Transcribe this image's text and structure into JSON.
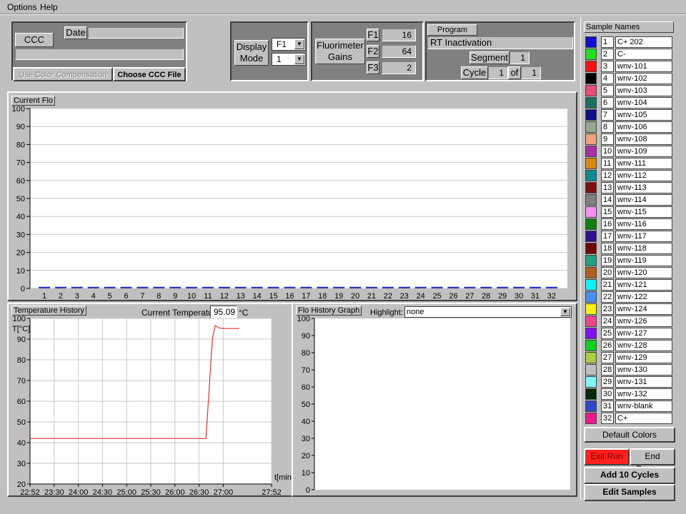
{
  "menu": {
    "options": "Options",
    "help": "Help"
  },
  "ccc": {
    "file_label": "CCC File",
    "date_label": "Date",
    "date_value": "",
    "file_value": "",
    "use_color_comp": "Use Color Compensation",
    "choose_button": "Choose CCC File"
  },
  "display": {
    "label": "Display Mode",
    "channel": "F1",
    "mode": "1"
  },
  "gains": {
    "label": "Fluorimeter Gains",
    "items": [
      {
        "name": "F1",
        "value": "16"
      },
      {
        "name": "F2",
        "value": "64"
      },
      {
        "name": "F3",
        "value": "2"
      }
    ]
  },
  "program": {
    "label": "Program Name",
    "name": "RT Inactivation",
    "segment_label": "Segment",
    "segment_value": "1",
    "cycle_label": "Cycle",
    "cycle_value": "1",
    "of_label": "of",
    "cycle_total": "1"
  },
  "current_flo": {
    "label": "Current Flo",
    "colors": {
      "bar": "#2a35c8",
      "grid": "#c0c0c0"
    }
  },
  "temp_history": {
    "label": "Temperature History",
    "current_label": "Current Temperature",
    "current_value": "95.09",
    "unit": "°C",
    "y_axis_label": "T[°C]",
    "x_axis_label": "t[min]",
    "line_color": "#e03030"
  },
  "flo_history": {
    "label": "Flo History Graph",
    "highlight_label": "Highlight:",
    "highlight_value": "none"
  },
  "chart_data": [
    {
      "type": "bar",
      "title": "Current Flo",
      "categories": [
        "1",
        "2",
        "3",
        "4",
        "5",
        "6",
        "7",
        "8",
        "9",
        "10",
        "11",
        "12",
        "13",
        "14",
        "15",
        "16",
        "17",
        "18",
        "19",
        "20",
        "21",
        "22",
        "23",
        "24",
        "25",
        "26",
        "27",
        "28",
        "29",
        "30",
        "31",
        "32"
      ],
      "values": [
        0.5,
        0.5,
        0.5,
        0.5,
        0.5,
        0.5,
        0.5,
        0.5,
        0.5,
        0.5,
        0.5,
        0.5,
        0.5,
        0.5,
        0.5,
        0.5,
        0.5,
        0.5,
        0.5,
        0.5,
        0.5,
        0.5,
        0.5,
        0.5,
        0.5,
        0.5,
        0.5,
        0.5,
        0.5,
        0.5,
        0.5,
        0.5
      ],
      "ylim": [
        0,
        100
      ],
      "yticks": [
        "0",
        "10",
        "20",
        "30",
        "40",
        "50",
        "60",
        "70",
        "80",
        "90",
        "100"
      ],
      "grid": true
    },
    {
      "type": "line",
      "title": "Temperature History",
      "ylabel": "T[°C]",
      "xlabel": "t[min]",
      "ylim": [
        20,
        100
      ],
      "xlim": [
        0,
        60
      ],
      "yticks": [
        "20",
        "30",
        "40",
        "50",
        "60",
        "70",
        "80",
        "90",
        "100"
      ],
      "xticks": [
        {
          "t": 0,
          "label": "22:52"
        },
        {
          "t": 6,
          "label": "23:30"
        },
        {
          "t": 12,
          "label": "24:00"
        },
        {
          "t": 18,
          "label": "24:30"
        },
        {
          "t": 24,
          "label": "25:00"
        },
        {
          "t": 30,
          "label": "25:30"
        },
        {
          "t": 36,
          "label": "26:00"
        },
        {
          "t": 42,
          "label": "26:30"
        },
        {
          "t": 48,
          "label": "27:00"
        },
        {
          "t": 60,
          "label": "27:52"
        }
      ],
      "x": [
        0,
        10,
        20,
        30,
        40,
        43.7,
        45.3,
        46.0,
        46.8,
        48.0,
        52.0
      ],
      "y": [
        42,
        42,
        42,
        42,
        42,
        42,
        90,
        96.5,
        95.5,
        95.1,
        95.1
      ],
      "grid": true
    },
    {
      "type": "line",
      "title": "Flo History Graph",
      "ylim": [
        0,
        100
      ],
      "yticks": [
        "0",
        "10",
        "20",
        "30",
        "40",
        "50",
        "60",
        "70",
        "80",
        "90",
        "100"
      ],
      "x": [],
      "y": []
    }
  ],
  "samples": {
    "label": "Sample Names",
    "items": [
      {
        "num": "1",
        "name": "C+ 202",
        "color": "#1010d0"
      },
      {
        "num": "2",
        "name": "C-",
        "color": "#20e020"
      },
      {
        "num": "3",
        "name": "wnv-101",
        "color": "#ff1010"
      },
      {
        "num": "4",
        "name": "wnv-102",
        "color": "#000000"
      },
      {
        "num": "5",
        "name": "wnv-103",
        "color": "#e84f7a"
      },
      {
        "num": "6",
        "name": "wnv-104",
        "color": "#1a7060"
      },
      {
        "num": "7",
        "name": "wnv-105",
        "color": "#10108a"
      },
      {
        "num": "8",
        "name": "wnv-106",
        "color": "#98a890"
      },
      {
        "num": "9",
        "name": "wnv-108",
        "color": "#f0a080"
      },
      {
        "num": "10",
        "name": "wnv-109",
        "color": "#a830a8"
      },
      {
        "num": "11",
        "name": "wnv-111",
        "color": "#d88a10"
      },
      {
        "num": "12",
        "name": "wnv-112",
        "color": "#108890"
      },
      {
        "num": "13",
        "name": "wnv-113",
        "color": "#801010"
      },
      {
        "num": "14",
        "name": "wnv-114",
        "color": "#808080"
      },
      {
        "num": "15",
        "name": "wnv-115",
        "color": "#f890f0"
      },
      {
        "num": "16",
        "name": "wnv-116",
        "color": "#108010"
      },
      {
        "num": "17",
        "name": "wnv-117",
        "color": "#301090"
      },
      {
        "num": "18",
        "name": "wnv-118",
        "color": "#700808"
      },
      {
        "num": "19",
        "name": "wnv-119",
        "color": "#20a080"
      },
      {
        "num": "20",
        "name": "wnv-120",
        "color": "#b06020"
      },
      {
        "num": "21",
        "name": "wnv-121",
        "color": "#10f0f8"
      },
      {
        "num": "22",
        "name": "wnv-122",
        "color": "#4890f0"
      },
      {
        "num": "23",
        "name": "wnv-124",
        "color": "#f8f010"
      },
      {
        "num": "24",
        "name": "wnv-126",
        "color": "#f04890"
      },
      {
        "num": "25",
        "name": "wnv-127",
        "color": "#8010f0"
      },
      {
        "num": "26",
        "name": "wnv-128",
        "color": "#10d020"
      },
      {
        "num": "27",
        "name": "wnv-129",
        "color": "#a8d040"
      },
      {
        "num": "28",
        "name": "wnv-130",
        "color": "#c0c0c0"
      },
      {
        "num": "29",
        "name": "wnv-131",
        "color": "#80f8f8"
      },
      {
        "num": "30",
        "name": "wnv-132",
        "color": "#082808"
      },
      {
        "num": "31",
        "name": "wnv-blank",
        "color": "#3048c8"
      },
      {
        "num": "32",
        "name": "C+",
        "color": "#f01890"
      }
    ],
    "default_colors": "Default Colors"
  },
  "actions": {
    "exit_run": "Exit Run",
    "end_program": "End Program",
    "add_cycles": "Add 10 Cycles",
    "edit_samples": "Edit Samples",
    "exit_color": "#ff2020"
  }
}
